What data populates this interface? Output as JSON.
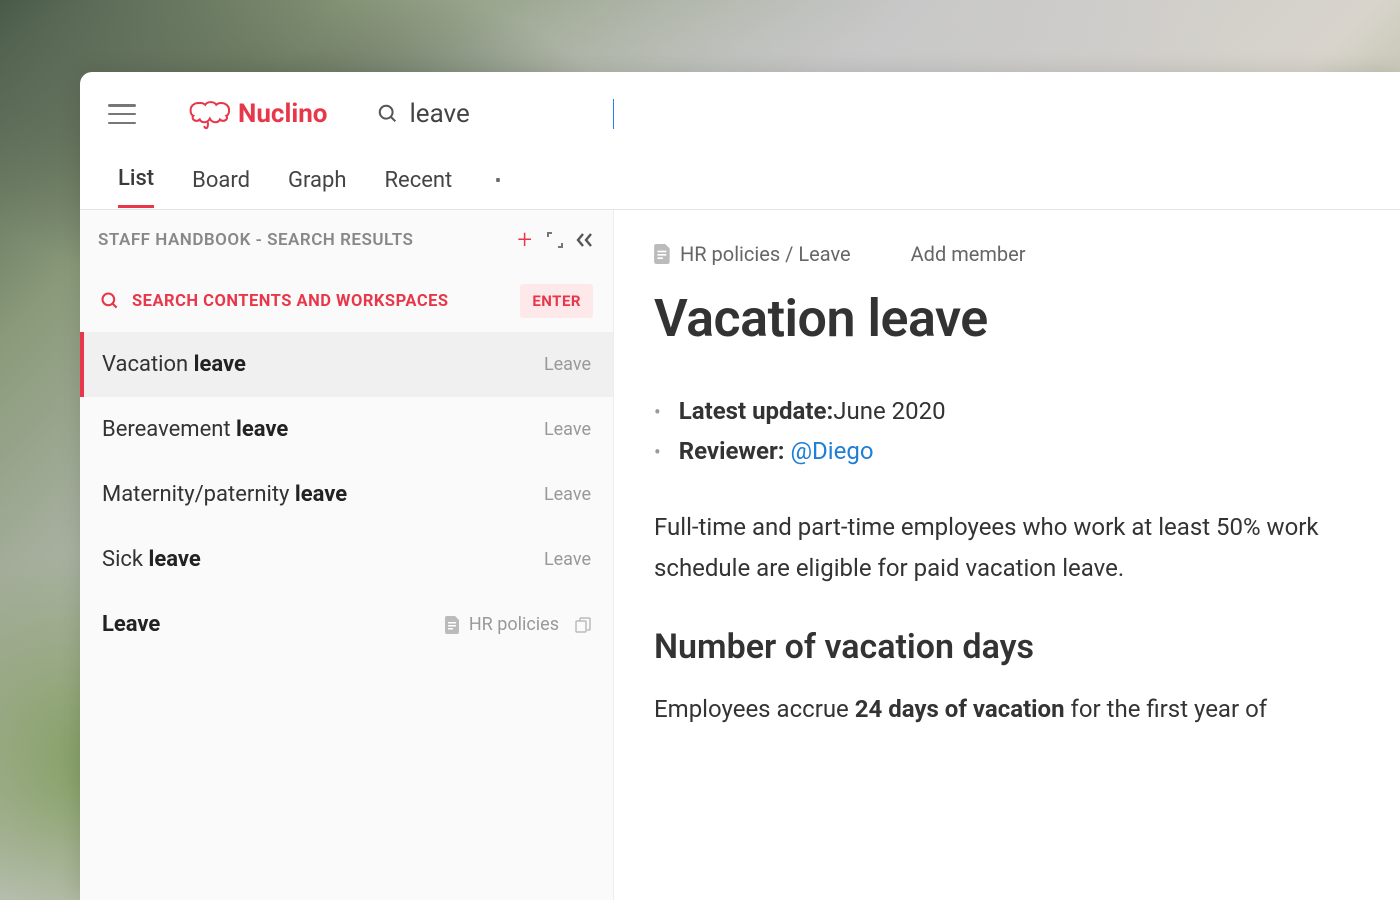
{
  "brand": {
    "name": "Nuclino"
  },
  "search": {
    "query": "leave"
  },
  "tabs": {
    "items": [
      "List",
      "Board",
      "Graph",
      "Recent"
    ],
    "active": 0
  },
  "sidebar": {
    "header": "STAFF HANDBOOK - SEARCH RESULTS",
    "search_all_label": "SEARCH CONTENTS AND WORKSPACES",
    "enter_label": "ENTER",
    "results": [
      {
        "prefix": "Vacation ",
        "match": "leave",
        "suffix": "",
        "category": "Leave",
        "active": true
      },
      {
        "prefix": "Bereavement ",
        "match": "leave",
        "suffix": "",
        "category": "Leave",
        "active": false
      },
      {
        "prefix": "Maternity/paternity ",
        "match": "leave",
        "suffix": "",
        "category": "Leave",
        "active": false
      },
      {
        "prefix": "Sick ",
        "match": "leave",
        "suffix": "",
        "category": "Leave",
        "active": false
      },
      {
        "prefix": "",
        "match": "Leave",
        "suffix": "",
        "category": "HR policies",
        "active": false,
        "is_collection": true
      }
    ]
  },
  "doc": {
    "breadcrumb": "HR policies / Leave",
    "add_member": "Add member",
    "title": "Vacation leave",
    "meta": {
      "latest_update_label": "Latest update:",
      "latest_update_value": " June 2020",
      "reviewer_label": "Reviewer:",
      "reviewer_mention": "@Diego"
    },
    "intro": "Full-time and part-time employees who work at least 50% work schedule are eligible for paid vacation leave.",
    "section1_title": "Number of vacation days",
    "section1_body_pre": "Employees accrue ",
    "section1_body_strong": "24 days of vacation",
    "section1_body_post": " for the first year of"
  }
}
